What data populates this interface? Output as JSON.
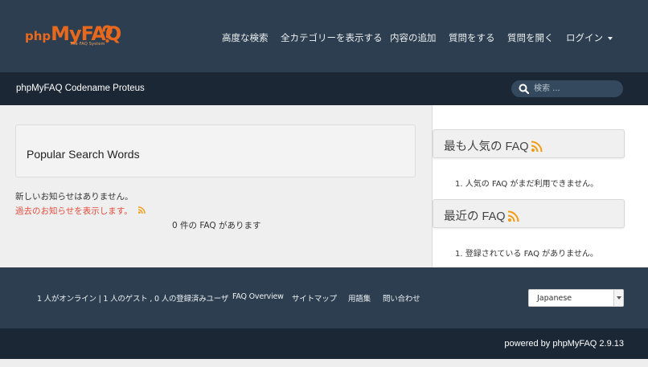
{
  "logo": {
    "php": "php",
    "myfaq": "MyFAQ",
    "tagline": "The FAQ System",
    "brand_color": "#e8691d"
  },
  "nav": {
    "items": [
      {
        "label": "高度な検索"
      },
      {
        "label": "全カテゴリーを表示する"
      },
      {
        "label": "内容の追加"
      },
      {
        "label": "質問をする"
      },
      {
        "label": "質問を開く"
      },
      {
        "label": "ログイン"
      }
    ]
  },
  "subbar": {
    "brand": "phpMyFAQ Codename Proteus"
  },
  "search": {
    "placeholder": "検索 ...",
    "icon": "search-icon"
  },
  "main": {
    "panel_title": "Popular Search Words",
    "no_news": "新しいお知らせはありません。",
    "archive_link": "過去のお知らせを表示します。",
    "faq_count": "0 件の FAQ があります"
  },
  "sidebar": {
    "popular_title": "最も人気の FAQ",
    "popular_item": "1. 人気の FAQ がまだ利用できません。",
    "latest_title": "最近の FAQ",
    "latest_item": "1. 登録されている FAQ がありません。"
  },
  "footer": {
    "links": [
      {
        "label": "1 人がオンライン | 1 人のゲスト , 0 人の登録済みユーザ"
      },
      {
        "label": "FAQ Overview"
      },
      {
        "label": "サイトマップ"
      },
      {
        "label": "用語集"
      },
      {
        "label": "問い合わせ"
      }
    ],
    "language": "Japanese"
  },
  "powered_by": "powered by phpMyFAQ 2.9.13",
  "colors": {
    "nav_bg": "#2c3e50",
    "dark_bg": "#1b2735",
    "accent_red": "#e74c3c",
    "rss_orange": "#f39c12"
  }
}
